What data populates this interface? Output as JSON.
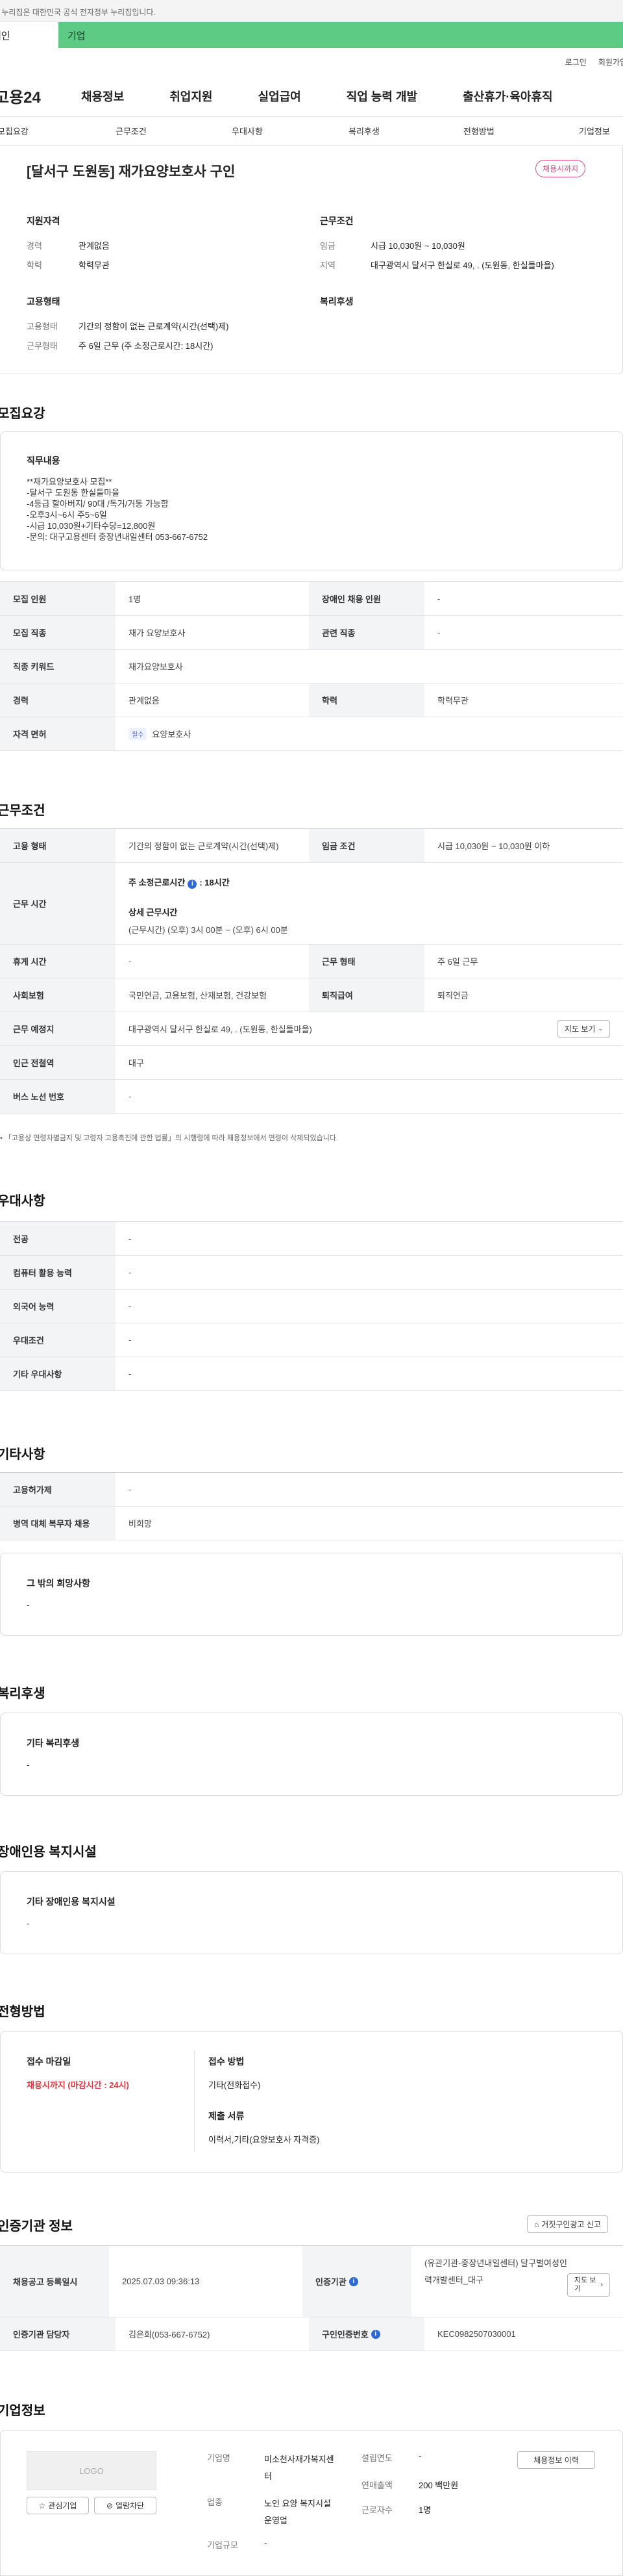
{
  "gov_notice": "이 누리집은 대한민국 공식 전자정부 누리집입니다.",
  "audience_tabs": [
    "개인",
    "기업"
  ],
  "util_links": [
    "로그인",
    "회원가입"
  ],
  "logo": "고용24",
  "gnb": [
    "채용정보",
    "취업지원",
    "실업급여",
    "직업 능력 개발",
    "출산휴가·육아휴직"
  ],
  "subnav": [
    "모집요강",
    "근무조건",
    "우대사항",
    "복리후생",
    "전형방법",
    "기업정보"
  ],
  "job": {
    "title": "[달서구 도원동] 재가요양보호사 구인",
    "status_badge": "채용시까지",
    "qual_head": "지원자격",
    "cond_head": "근무조건",
    "career_label": "경력",
    "career_value": "관계없음",
    "edu_label": "학력",
    "edu_value": "학력무관",
    "wage_label": "임금",
    "wage_value": "시급 10,030원 ~ 10,030원",
    "area_label": "지역",
    "area_value": "대구광역시 달서구 한실로 49, . (도원동, 한실들마을)",
    "emp_head": "고용형태",
    "welfare_head": "복리후생",
    "emp_label": "고용형태",
    "emp_value": "기간의 정함이 없는 근로계약(시간(선택)제)",
    "worktype_label": "근무형태",
    "worktype_value": "주 6일 근무 (주 소정근로시간: 18시간)"
  },
  "recruit": {
    "title": "모집요강",
    "duty_head": "직무내용",
    "duty_lines": [
      "**재가요양보호사 모집**",
      "-달서구 도원동 한실들마을",
      "-4등급 할아버지/ 90대 /독거/거동 가능함",
      "-오후3시~6시 주5~6일",
      "-시급 10,030원+기타수당=12,800원",
      "-문의: 대구고용센터 중장년내일센터 053-667-6752"
    ],
    "rows": [
      {
        "k1": "모집 인원",
        "v1": "1명",
        "k2": "장애인 채용 인원",
        "v2": "-"
      },
      {
        "k1": "모집 직종",
        "v1": "재가 요양보호사",
        "k2": "관련 직종",
        "v2": "-"
      },
      {
        "k1": "직종 키워드",
        "v1": "재가요양보호사"
      },
      {
        "k1": "경력",
        "v1": "관계없음",
        "k2": "학력",
        "v2": "학력무관"
      },
      {
        "k1": "자격 면허",
        "pill": "필수",
        "v1": "요양보호사"
      }
    ]
  },
  "work": {
    "title": "근무조건",
    "emp_type_label": "고용 형태",
    "emp_type_value": "기간의 정함이 없는 근로계약(시간(선택)제)",
    "wage_label": "임금 조건",
    "wage_value": "시급 10,030원 ~ 10,030원 이하",
    "hours_label": "근무 시간",
    "hours_main": "주 소정근로시간",
    "hours_main_value": ": 18시간",
    "hours_detail_head": "상세 근무시간",
    "hours_detail": "(근무시간) (오후) 3시 00분 ~ (오후) 6시 00분",
    "rest_label": "휴게 시간",
    "rest_value": "-",
    "worktype_label": "근무 형태",
    "worktype_value": "주 6일 근무",
    "insurance_label": "사회보험",
    "insurance_value": "국민연금, 고용보험, 산재보험, 건강보험",
    "retire_label": "퇴직급여",
    "retire_value": "퇴직연금",
    "place_label": "근무 예정지",
    "place_value": "대구광역시 달서구 한실로 49, . (도원동, 한실들마을)",
    "map_button": "지도 보기",
    "subway_label": "인근 전철역",
    "subway_value": "대구",
    "bus_label": "버스 노선 번호",
    "bus_value": "-",
    "footnote": "「고용상 연령차별금지 및 고령자 고용촉진에 관한 법률」의 시행령에 따라 채용정보에서 연령이 삭제되었습니다."
  },
  "pref": {
    "title": "우대사항",
    "rows": [
      {
        "k": "전공",
        "v": "-"
      },
      {
        "k": "컴퓨터 활용 능력",
        "v": "-"
      },
      {
        "k": "외국어 능력",
        "v": "-"
      },
      {
        "k": "우대조건",
        "v": "-"
      },
      {
        "k": "기타 우대사항",
        "v": "-"
      }
    ]
  },
  "etc": {
    "title": "기타사항",
    "rows": [
      {
        "k": "고용허가제",
        "v": "-"
      },
      {
        "k": "병역 대체 복무자 채용",
        "v": "비희망"
      }
    ],
    "box_head": "그 밖의 희망사항",
    "box_value": "-"
  },
  "welfare": {
    "title": "복리후생",
    "box_head": "기타 복리후생",
    "box_value": "-"
  },
  "disabled": {
    "title": "장애인용 복지시설",
    "box_head": "기타 장애인용 복지시설",
    "box_value": "-"
  },
  "process": {
    "title": "전형방법",
    "deadline_head": "접수 마감일",
    "deadline_value": "채용시까지 (마감시간 : 24시)",
    "method_head": "접수 방법",
    "method_value": "기타(전화접수)",
    "docs_head": "제출 서류",
    "docs_value": "이력서,기타(요양보호사 자격증)"
  },
  "cert": {
    "title": "인증기관 정보",
    "report_button": "거짓구인광고 신고",
    "reg_label": "채용공고 등록일시",
    "reg_value": "2025.07.03 09:36:13",
    "org_label": "인증기관",
    "org_value": "(유관기관-중장년내일센터) 달구벌여성인력개발센터_대구",
    "org_map": "지도 보기",
    "mgr_label": "인증기관 담당자",
    "mgr_value": "김은희(053-667-6752)",
    "no_label": "구인인증번호",
    "no_value": "KEC0982507030001"
  },
  "company": {
    "title": "기업정보",
    "logo_text": "LOGO",
    "fav_button": "관심기업",
    "block_button": "열람차단",
    "name_label": "기업명",
    "name_value": "미소천사재가복지센터",
    "year_label": "설립연도",
    "year_value": "-",
    "industry_label": "업종",
    "industry_value": "노인 요양 복지시설 운영업",
    "sales_label": "연매출액",
    "sales_value": "200 백만원",
    "staff_label": "근로자수",
    "staff_value": "1명",
    "scale_label": "기업규모",
    "scale_value": "-",
    "jobs_button": "채용정보 이력"
  }
}
